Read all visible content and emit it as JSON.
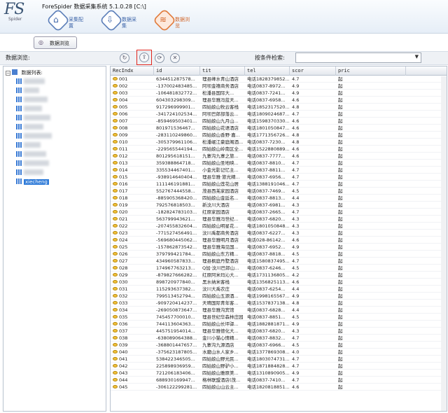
{
  "app": {
    "logo": "FS",
    "logo_sub": "Spider",
    "title": "ForeSpider 数据采集系统 5.1.0.28  [C:\\]"
  },
  "main_buttons": [
    {
      "icon": "home-icon",
      "label": "采集配置"
    },
    {
      "icon": "download-icon",
      "label": "数据采集"
    },
    {
      "icon": "database-icon",
      "label": "数据浏览",
      "active": true
    }
  ],
  "view_tab": {
    "label": "数据浏览"
  },
  "left_panel": {
    "title": "数据浏览:",
    "root_label": "数据列表:",
    "selected_item": "xiecheng"
  },
  "search": {
    "label": "按条件检索:",
    "value": ""
  },
  "table": {
    "columns": [
      "RecIndx",
      "id",
      "tit",
      "tel",
      "scor",
      "pric"
    ],
    "rows": [
      [
        "001",
        "634451287578...",
        "理县峰水青山酒店",
        "电话1828379852...",
        "4.7",
        "起"
      ],
      [
        "002",
        "-137002483485...",
        "阿坝金禧商务酒店",
        "电话0837-8972...",
        "4.9",
        "起"
      ],
      [
        "003",
        "-106481832772...",
        "松潘县国际大...",
        "电话0837-7241...",
        "4.9",
        "起"
      ],
      [
        "004",
        "604303298309...",
        "理县华雅冯蓝天...",
        "电话0837-6958...",
        "4.6",
        "起"
      ],
      [
        "005",
        "917296999901...",
        "四姑娘山牧云客栈",
        "电话1852317520...",
        "4.8",
        "起"
      ],
      [
        "006",
        "-341724102534...",
        "阿坝巴郎部落云...",
        "电话1809024687...",
        "4.7",
        "起"
      ],
      [
        "007",
        "-859469503401...",
        "四姑娘山九月山...",
        "电话1598370330...",
        "4.6",
        "起"
      ],
      [
        "008",
        "801971536467...",
        "四姑娘山花语酒店",
        "电话1801050847...",
        "4.6",
        "起"
      ],
      [
        "009",
        "-283110249860...",
        "四姑娘山香野·嘉...",
        "电话1771356726...",
        "4.8",
        "起"
      ],
      [
        "010",
        "-305379961106...",
        "松潘岷江豪庭阁酒...",
        "电话0837-7230...",
        "4.8",
        "起"
      ],
      [
        "011",
        "-229565544194...",
        "四姑娘山岭南区全...",
        "电话1522880889...",
        "4.6",
        "起"
      ],
      [
        "012",
        "801295618151...",
        "九寨沟九寨之旅...",
        "电话0837-7777...",
        "4.6",
        "起"
      ],
      [
        "013",
        "359388864718...",
        "四姑娘山圣地映...",
        "电话0837-8810...",
        "4.7",
        "起"
      ],
      [
        "014",
        "335534467401...",
        "小金光影记忆主...",
        "电话0837-8811...",
        "4.7",
        "起"
      ],
      [
        "015",
        "-938914640404...",
        "理县华雅·旅光精...",
        "电话0837-6956...",
        "4.7",
        "起"
      ],
      [
        "016",
        "111146191881...",
        "四姑娘山莲花山居",
        "电话1388191046...",
        "4.7",
        "起"
      ],
      [
        "017",
        "552767444558...",
        "茂县西羌家园酒店",
        "电话0837-7469...",
        "4.5",
        "起"
      ],
      [
        "018",
        "-885905368420...",
        "四姑娘山金廷名...",
        "电话0837-8813...",
        "4.4",
        "起"
      ],
      [
        "019",
        "792576818503...",
        "新汶川大酒店",
        "电话0837-6981...",
        "4.3",
        "起"
      ],
      [
        "020",
        "-182824783103...",
        "红原家园酒店",
        "电话0837-2665...",
        "4.7",
        "起"
      ],
      [
        "021",
        "563799943621...",
        "理县华雅冯世纪...",
        "电话0837-6820...",
        "4.3",
        "起"
      ],
      [
        "022",
        "-207455832604...",
        "四姑娘山明星花...",
        "电话1801050848...",
        "4.3",
        "起"
      ],
      [
        "023",
        "-771527456491...",
        "汶川禹都商务酒店",
        "电话0837-6227...",
        "4.3",
        "起"
      ],
      [
        "024",
        "-569680445062...",
        "理县华雅明月酒店",
        "电话028-86142...",
        "4.6",
        "起"
      ],
      [
        "025",
        "-157862873542...",
        "理县华雅海见国...",
        "电话0837-6952...",
        "4.9",
        "起"
      ],
      [
        "026",
        "379799421784...",
        "四姑娘山东方精...",
        "电话0837-8818...",
        "4.5",
        "起"
      ],
      [
        "027",
        "434960587833...",
        "理县枫庭丹墅酒店",
        "电话1580837495...",
        "4.7",
        "起"
      ],
      [
        "028",
        "174967763213...",
        "Q加·汶川巴郎山...",
        "电话0837-6246...",
        "4.5",
        "起"
      ],
      [
        "029",
        "-879827666282...",
        "红原阿米玛沁大...",
        "电话1731136805...",
        "4.2",
        "起"
      ],
      [
        "030",
        "898720977840...",
        "黑水纳米客栈",
        "电话1356825113...",
        "4.6",
        "起"
      ],
      [
        "031",
        "115293637382...",
        "汶川大禹农庄",
        "电话0837-6254...",
        "4.4",
        "起"
      ],
      [
        "032",
        "799513452794...",
        "四姑娘山五源酒...",
        "电话1998165567...",
        "4.9",
        "起"
      ],
      [
        "033",
        "-909720414237...",
        "天晴国际青年客...",
        "电话1537837138...",
        "4.8",
        "起"
      ],
      [
        "034",
        "-269050873647...",
        "理县华雅沟宾馆",
        "电话0837-6828...",
        "4.4",
        "起"
      ],
      [
        "035",
        "745457700010...",
        "理县世纪华森林庄园",
        "电话0837-8851...",
        "4.5",
        "起"
      ],
      [
        "036",
        "744113604363...",
        "四姑娘山长坪驿...",
        "电话1882881871...",
        "4.9",
        "起"
      ],
      [
        "037",
        "445751954014...",
        "理县华雅德化大...",
        "电话0837-6820...",
        "4.3",
        "起"
      ],
      [
        "038",
        "-638089064388...",
        "金川小猫心情精...",
        "电话0837-8832...",
        "4.7",
        "起"
      ],
      [
        "039",
        "-368801447657...",
        "九寨沟九源酒店",
        "电话0837-6966...",
        "4.5",
        "起"
      ],
      [
        "040",
        "-375623187805...",
        "水磨山水人家乡...",
        "电话1377869308...",
        "4.0",
        "起"
      ],
      [
        "041",
        "538422346505...",
        "四姑娘山野光民...",
        "电话1803074731...",
        "4.7",
        "起"
      ],
      [
        "042",
        "225898936959...",
        "四姑娘山野驴小...",
        "电话1871884828...",
        "4.7",
        "起"
      ],
      [
        "043",
        "721206183406...",
        "四姑娘山雅原美...",
        "电话1310890905...",
        "4.9",
        "起"
      ],
      [
        "044",
        "688930169947...",
        "格林联盟酒店(茂...",
        "电话0837-7410...",
        "4.7",
        "起"
      ],
      [
        "045",
        "-306122299281...",
        "四姑娘山山云主...",
        "电话1820818851...",
        "4.6",
        "起"
      ]
    ]
  }
}
